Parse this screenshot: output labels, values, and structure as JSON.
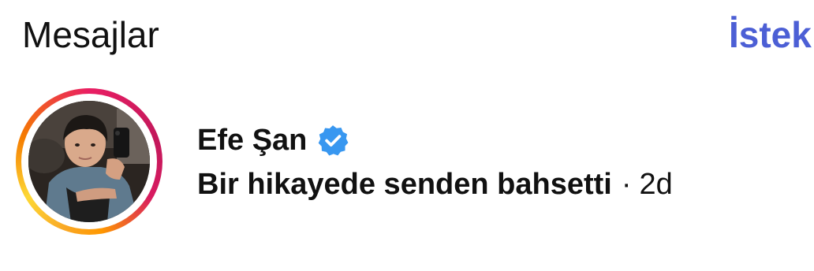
{
  "header": {
    "title": "Mesajlar",
    "requests_label": "İstek"
  },
  "thread": {
    "name": "Efe Şan",
    "verified_icon": "verified-badge-icon",
    "preview": "Bir hikayede senden bahsetti",
    "separator": "·",
    "time": "2d",
    "story_ring": true
  },
  "colors": {
    "accent": "#4c5fd5",
    "verified": "#3897f0",
    "text": "#111111"
  }
}
